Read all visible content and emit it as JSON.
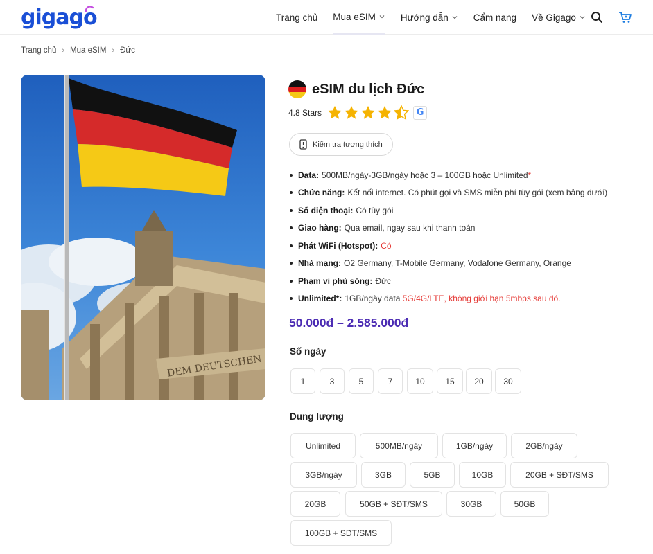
{
  "header": {
    "logo_text": "gigago",
    "nav": [
      {
        "label": "Trang chủ"
      },
      {
        "label": "Mua eSIM"
      },
      {
        "label": "Hướng dẫn"
      },
      {
        "label": "Cẩm nang"
      },
      {
        "label": "Về Gigago"
      }
    ],
    "icons": [
      "search-icon",
      "cart-icon"
    ]
  },
  "breadcrumb": [
    "Trang chủ",
    "Mua eSIM",
    "Đức"
  ],
  "hero": {
    "text": "DEM DEUTSCHEN"
  },
  "product": {
    "title": "eSIM du lịch Đức",
    "rating_text": "4.8 Stars",
    "rating": 4.5,
    "compat_button": "Kiểm tra tương thích",
    "specs": [
      {
        "label": "Data:",
        "value": "500MB/ngày-3GB/ngày hoặc 3 – 100GB hoặc Unlimited",
        "red_suffix": "*"
      },
      {
        "label": "Chức năng:",
        "value": "Kết nối internet. Có phút gọi và SMS miễn phí tùy gói (xem bảng dưới)",
        "red_suffix": ""
      },
      {
        "label": "Số điện thoại:",
        "value": "Có tùy gói",
        "red_suffix": ""
      },
      {
        "label": "Giao hàng:",
        "value": "Qua email, ngay sau khi thanh toán",
        "red_suffix": ""
      },
      {
        "label": "Phát WiFi (Hotspot):",
        "value": "",
        "red_suffix": "Có"
      },
      {
        "label": "Nhà mạng:",
        "value": "O2 Germany, T-Mobile Germany, Vodafone Germany, Orange",
        "red_suffix": ""
      },
      {
        "label": "Phạm vi phủ sóng:",
        "value": "Đức",
        "red_suffix": ""
      },
      {
        "label": "Unlimited*:",
        "value": "1GB/ngày data",
        "red_suffix": "5G/4G/LTE, không giới hạn 5mbps sau đó."
      }
    ],
    "price": "50.000đ – 2.585.000đ",
    "days_label": "Số ngày",
    "days": [
      "1",
      "3",
      "5",
      "7",
      "10",
      "15",
      "20",
      "30"
    ],
    "capacity_label": "Dung lượng",
    "capacity": [
      "Unlimited",
      "500MB/ngày",
      "1GB/ngày",
      "2GB/ngày",
      "3GB/ngày",
      "3GB",
      "5GB",
      "10GB",
      "20GB + SĐT/SMS",
      "20GB",
      "50GB + SĐT/SMS",
      "30GB",
      "50GB",
      "100GB + SĐT/SMS"
    ]
  },
  "colors": {
    "brand": "#1a4fd6",
    "price": "#4b2bb3",
    "star": "#f5b301",
    "accent_red": "#e53935"
  }
}
